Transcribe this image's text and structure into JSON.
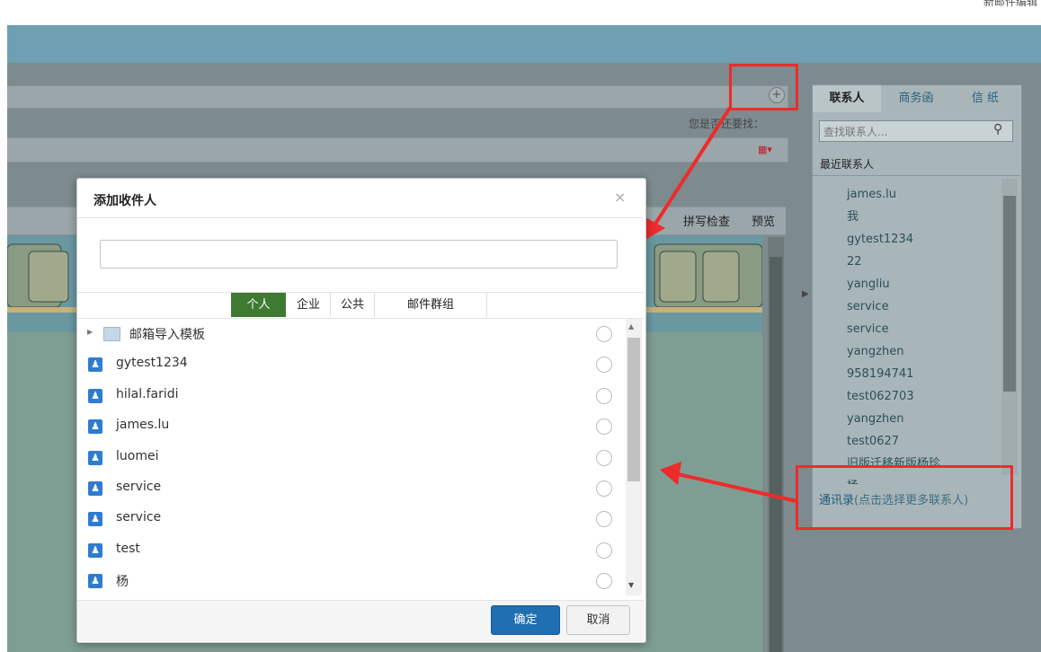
{
  "top": {
    "right_text": "新邮件编辑"
  },
  "compose": {
    "also_find_label": "您是否还要找：",
    "spell_check_label": "拼写检查",
    "preview_label": "预览"
  },
  "right_panel": {
    "tabs": [
      "联系人",
      "商务函",
      "信 纸"
    ],
    "search_placeholder": "查找联系人...",
    "recent_label": "最近联系人",
    "recent_contacts": [
      "james.lu",
      "我",
      "gytest1234",
      "22",
      "yangliu",
      "service",
      "service",
      "yangzhen",
      "958194741",
      "test062703",
      "yangzhen",
      "test0627",
      "旧版迁移新版杨珍",
      "杨"
    ],
    "address_book_link": "通讯录",
    "address_book_hint": "(点击选择更多联系人)"
  },
  "modal": {
    "title": "添加收件人",
    "close_symbol": "×",
    "recipient_value": "",
    "tabs": [
      "个人",
      "企业",
      "公共",
      "邮件群组"
    ],
    "active_tab": "个人",
    "folder_label": "邮箱导入模板",
    "contacts": [
      "gytest1234",
      "hilal.faridi",
      "james.lu",
      "luomei",
      "service",
      "service",
      "test",
      "杨"
    ],
    "ok_label": "确定",
    "cancel_label": "取消"
  },
  "colors": {
    "annotation_red": "#ee2b2b",
    "active_tab_green": "#3f7a33",
    "primary_blue": "#1f6fb2"
  },
  "icons": [
    "plus-circle-icon",
    "grid-icon",
    "search-icon",
    "user-icon",
    "folder-icon",
    "close-icon",
    "expand-arrow-icon"
  ]
}
